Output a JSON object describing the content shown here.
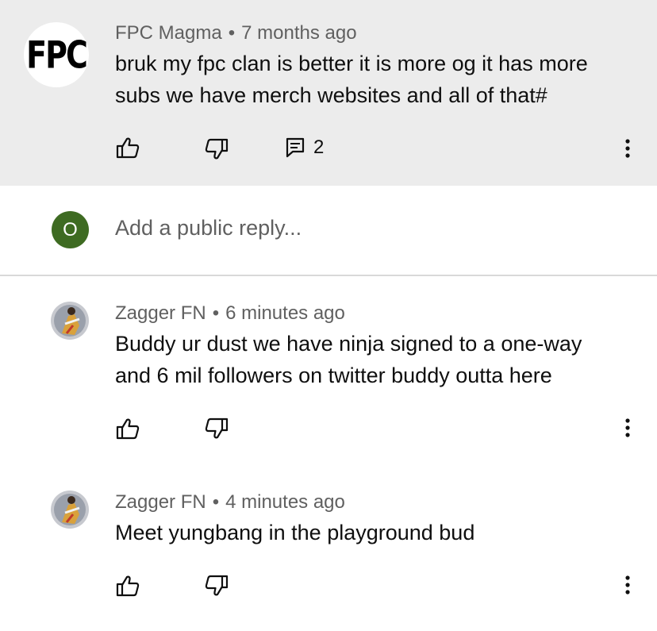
{
  "comment": {
    "avatar_text": "FPC",
    "author": "FPC Magma",
    "time": "7 months ago",
    "text": "bruk my fpc clan is better it is more og it has more subs we have merch websites and all of that#",
    "reply_count": "2"
  },
  "reply_box": {
    "avatar_letter": "O",
    "placeholder": "Add a public reply..."
  },
  "replies": [
    {
      "author": "Zagger FN",
      "time": "6 minutes ago",
      "text": "Buddy ur dust we have ninja signed to a one-way and 6 mil followers on twitter buddy outta here"
    },
    {
      "author": "Zagger FN",
      "time": "4 minutes ago",
      "text": "Meet yungbang in the playground bud"
    }
  ],
  "separator": "•",
  "colors": {
    "highlight_bg": "#ececec",
    "user_avatar_bg": "#3e6b22",
    "secondary_text": "#606060"
  }
}
